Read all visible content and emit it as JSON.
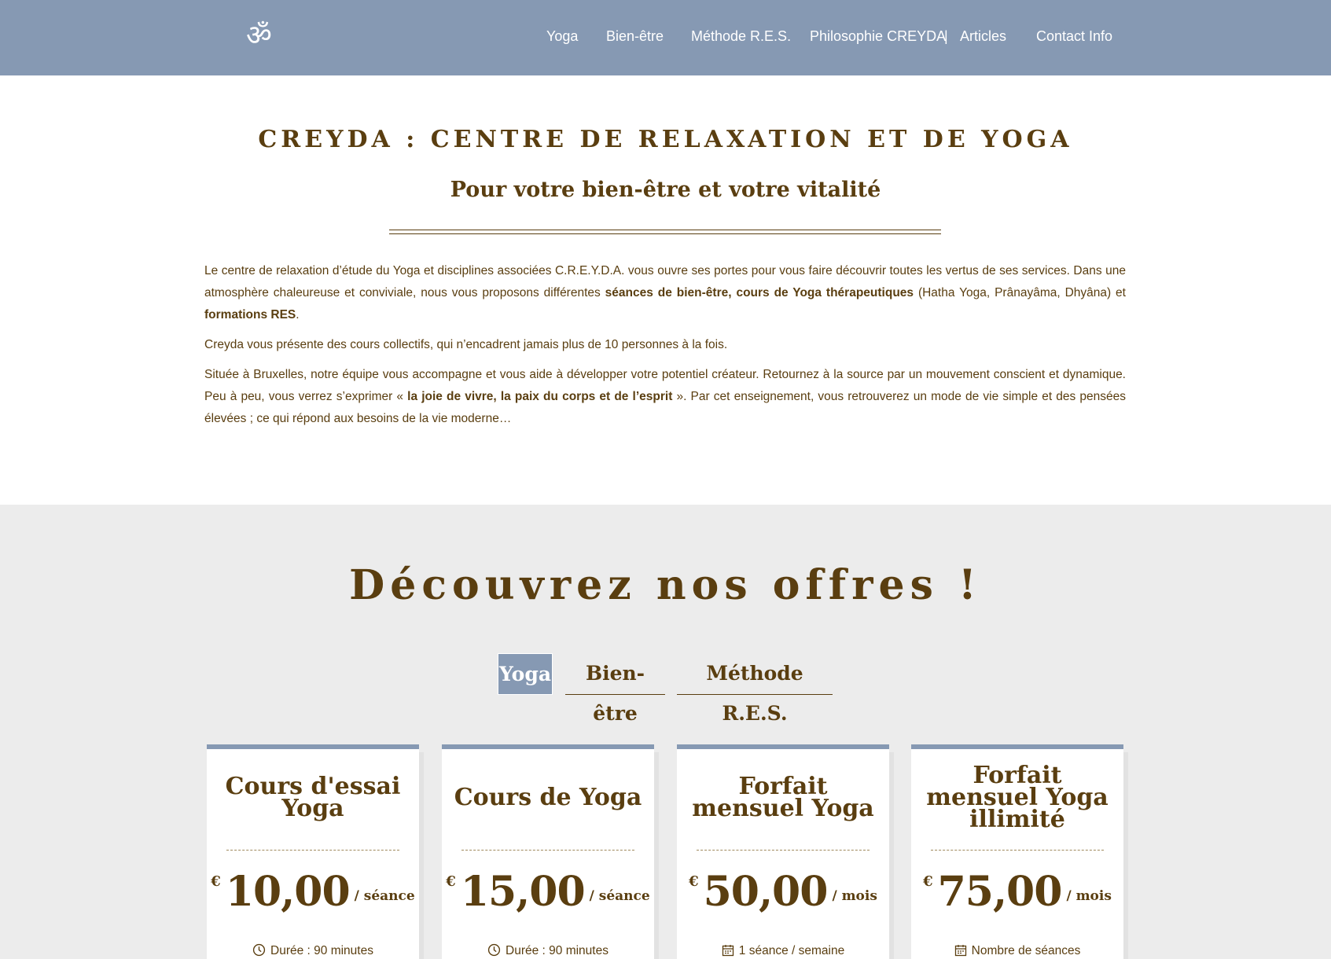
{
  "header": {
    "logo_glyph": "ॐ",
    "nav": [
      "Yoga",
      "Bien-être",
      "Méthode R.E.S.",
      "Philosophie CREYDA",
      "Articles",
      "Contact Info"
    ],
    "separator": "|"
  },
  "intro": {
    "title": "CREYDA : CENTRE DE RELAXATION ET DE YOGA",
    "subtitle": "Pour votre bien-être et votre vitalité",
    "p1_a": "Le centre de relaxation d’étude du Yoga et disciplines associées C.R.E.Y.D.A. vous ouvre ses portes pour vous faire découvrir toutes les vertus de ses services. Dans une atmosphère chaleureuse et conviviale, nous vous proposons différentes ",
    "p1_b": "séances de bien-être",
    "p1_c": ", ",
    "p1_d": "cours de Yoga thérapeutiques",
    "p1_e": " (Hatha Yoga, Prânayâma, Dhyâna) et ",
    "p1_f": "formations RES",
    "p1_g": ".",
    "p2": "Creyda vous présente des cours collectifs, qui n’encadrent jamais plus de 10 personnes à la fois.",
    "p3_a": "Située à Bruxelles, notre équipe vous accompagne et vous aide à développer votre potentiel créateur. Retournez à la source par un mouvement conscient et dynamique. Peu à peu, vous verrez s’exprimer « ",
    "p3_b": "la joie de vivre, la paix du corps et de l’esprit",
    "p3_c": " ». Par cet enseignement, vous retrouverez un mode de vie simple et des pensées élevées ; ce qui répond aux besoins de la vie moderne…"
  },
  "offers": {
    "title": "Découvrez nos offres !",
    "tabs": [
      "Yoga",
      "Bien-être",
      "Méthode R.E.S."
    ],
    "active_tab": "Yoga",
    "cards": [
      {
        "title_lines": [
          "Cours d'essai",
          "Yoga"
        ],
        "currency": "€",
        "amount": "10,00",
        "unit": "/ séance",
        "feature_icon": "clock-icon",
        "feature": "Durée : 90 minutes"
      },
      {
        "title_lines": [
          "Cours de Yoga"
        ],
        "currency": "€",
        "amount": "15,00",
        "unit": "/ séance",
        "feature_icon": "clock-icon",
        "feature": "Durée : 90 minutes"
      },
      {
        "title_lines": [
          "Forfait",
          "mensuel Yoga"
        ],
        "currency": "€",
        "amount": "50,00",
        "unit": "/ mois",
        "feature_icon": "calendar-icon",
        "feature": "1 séance / semaine"
      },
      {
        "title_lines": [
          "Forfait",
          "mensuel Yoga",
          "illimité"
        ],
        "currency": "€",
        "amount": "75,00",
        "unit": "/ mois",
        "feature_icon": "calendar-icon",
        "feature": "Nombre de séances"
      }
    ]
  },
  "colors": {
    "header_bg": "#8699b3",
    "text_brown": "#5a3e10",
    "section_bg": "#ececec",
    "card_accent": "#8699b3"
  }
}
